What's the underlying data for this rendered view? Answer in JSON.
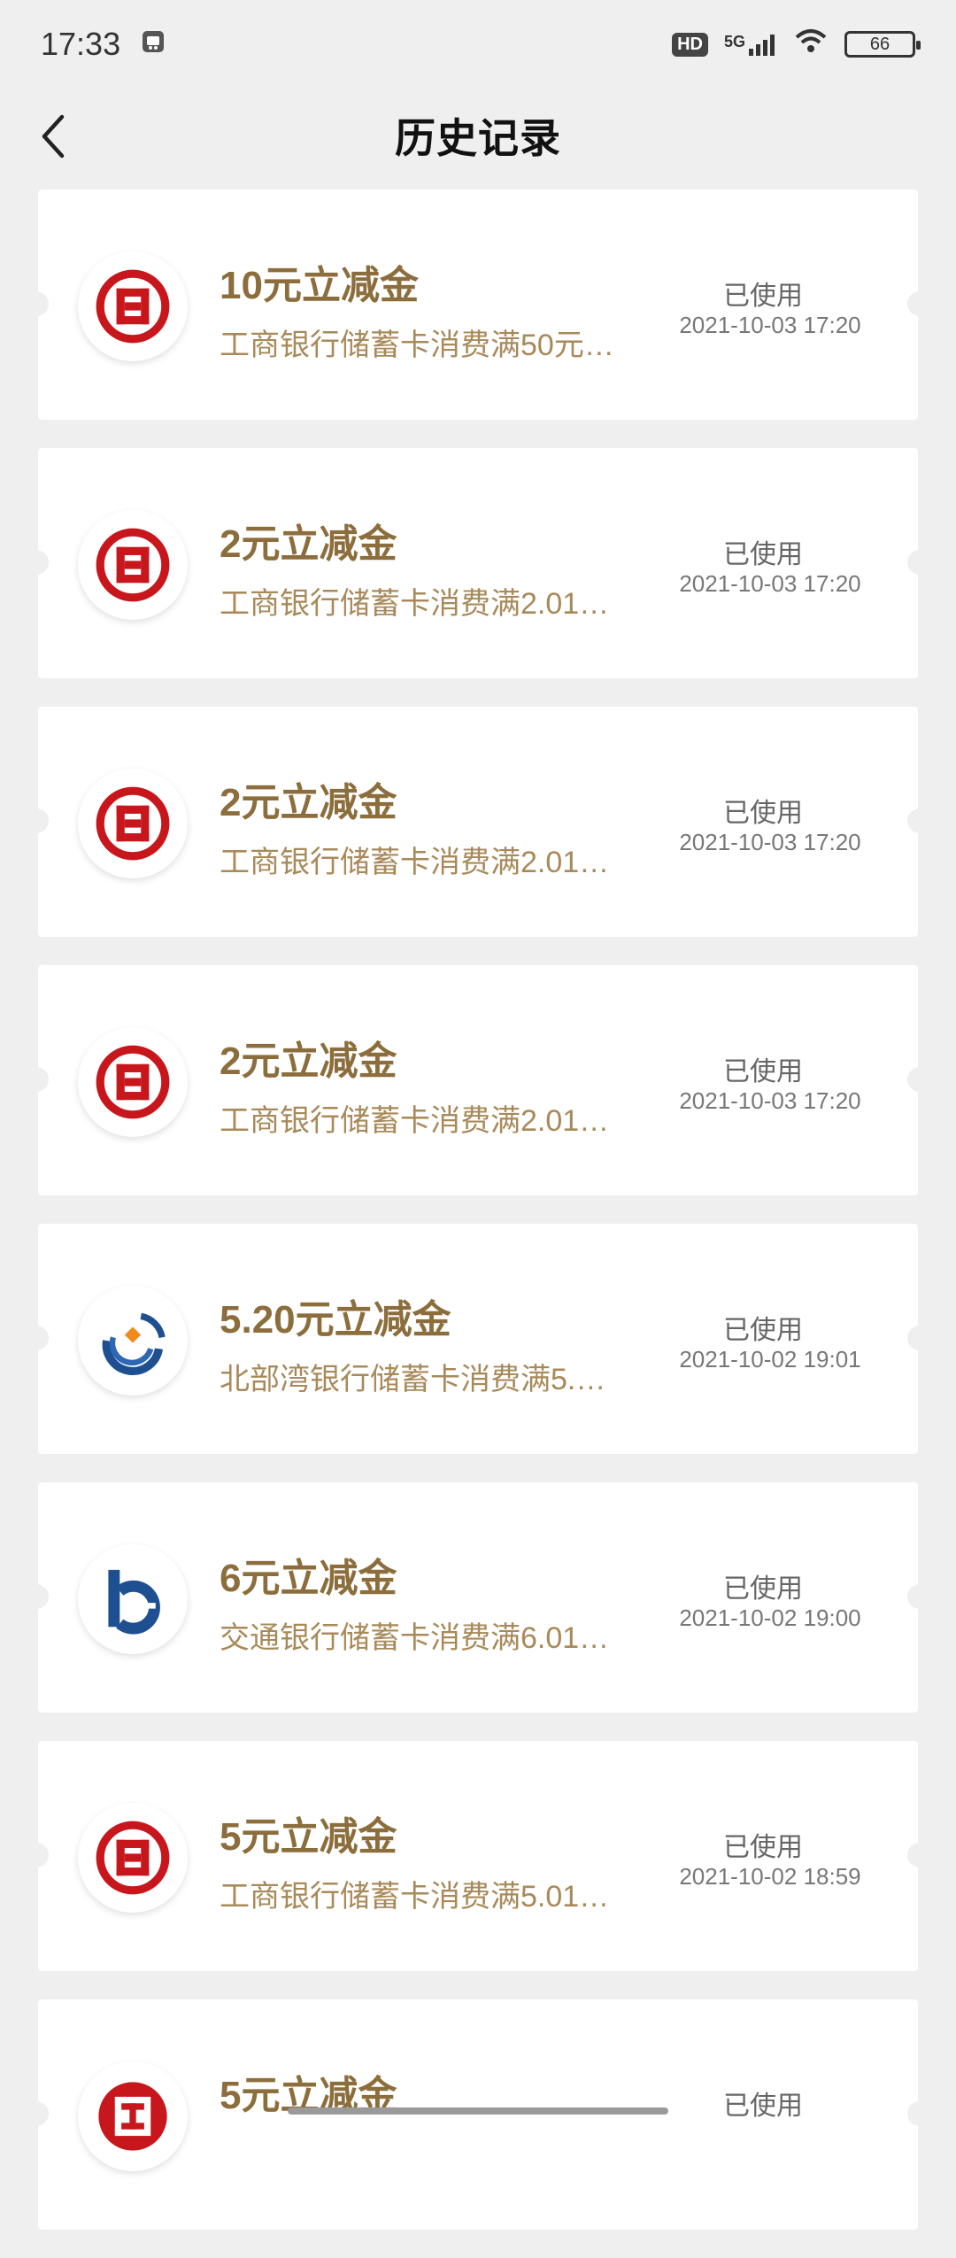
{
  "status_bar": {
    "time": "17:33",
    "network": "5G",
    "hd": "HD",
    "battery": "66"
  },
  "header": {
    "title": "历史记录"
  },
  "records": [
    {
      "bank": "icbc",
      "title": "10元立减金",
      "desc": "工商银行储蓄卡消费满50元…",
      "status": "已使用",
      "date": "2021-10-03 17:20"
    },
    {
      "bank": "icbc",
      "title": "2元立减金",
      "desc": "工商银行储蓄卡消费满2.01…",
      "status": "已使用",
      "date": "2021-10-03 17:20"
    },
    {
      "bank": "icbc",
      "title": "2元立减金",
      "desc": "工商银行储蓄卡消费满2.01…",
      "status": "已使用",
      "date": "2021-10-03 17:20"
    },
    {
      "bank": "icbc",
      "title": "2元立减金",
      "desc": "工商银行储蓄卡消费满2.01…",
      "status": "已使用",
      "date": "2021-10-03 17:20"
    },
    {
      "bank": "beibuwan",
      "title": "5.20元立减金",
      "desc": "北部湾银行储蓄卡消费满5.…",
      "status": "已使用",
      "date": "2021-10-02 19:01"
    },
    {
      "bank": "bocom",
      "title": "6元立减金",
      "desc": "交通银行储蓄卡消费满6.01…",
      "status": "已使用",
      "date": "2021-10-02 19:00"
    },
    {
      "bank": "icbc",
      "title": "5元立减金",
      "desc": "工商银行储蓄卡消费满5.01…",
      "status": "已使用",
      "date": "2021-10-02 18:59"
    },
    {
      "bank": "citic",
      "title": "5元立减金",
      "desc": "",
      "status": "已使用",
      "date": ""
    }
  ],
  "colors": {
    "accent": "#8c6d3c",
    "subtext": "#a88a5a",
    "icbc_red": "#c8161d",
    "bocom_blue": "#1e4f91"
  }
}
